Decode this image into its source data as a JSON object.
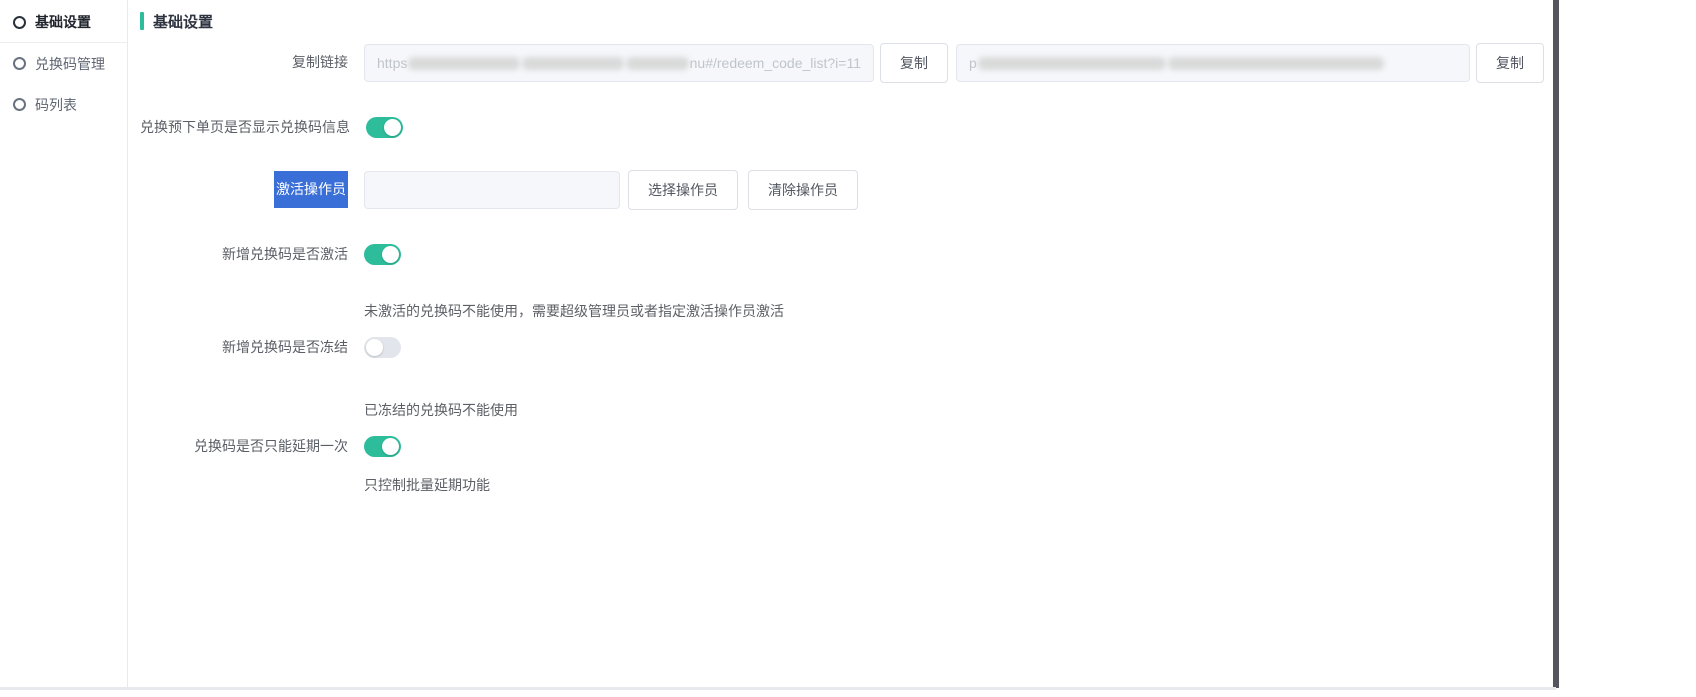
{
  "colors": {
    "accent_teal": "#2dbd9b",
    "selection_blue": "#3a6fd8",
    "disabled_input_bg": "#f5f7fa"
  },
  "sidebar": {
    "items": [
      {
        "label": "基础设置",
        "active": true
      },
      {
        "label": "兑换码管理",
        "active": false
      },
      {
        "label": "码列表",
        "active": false
      }
    ]
  },
  "main": {
    "title": "基础设置",
    "rows": {
      "copy_link": {
        "label": "复制链接",
        "input1_prefix": "https",
        "input1_suffix": "nu#/redeem_code_list?i=11",
        "copy_button": "复制",
        "input2_prefix": "p",
        "copy_button2": "复制"
      },
      "show_code_info": {
        "label": "兑换预下单页是否显示兑换码信息",
        "state": "on"
      },
      "activate_operator": {
        "label": "激活操作员",
        "input_value": "",
        "select_button": "选择操作员",
        "clear_button": "清除操作员"
      },
      "new_code_activated": {
        "label": "新增兑换码是否激活",
        "state": "on",
        "help": "未激活的兑换码不能使用，需要超级管理员或者指定激活操作员激活"
      },
      "new_code_frozen": {
        "label": "新增兑换码是否冻结",
        "state": "off",
        "help": "已冻结的兑换码不能使用"
      },
      "extend_once": {
        "label": "兑换码是否只能延期一次",
        "state": "on",
        "help": "只控制批量延期功能"
      }
    }
  }
}
